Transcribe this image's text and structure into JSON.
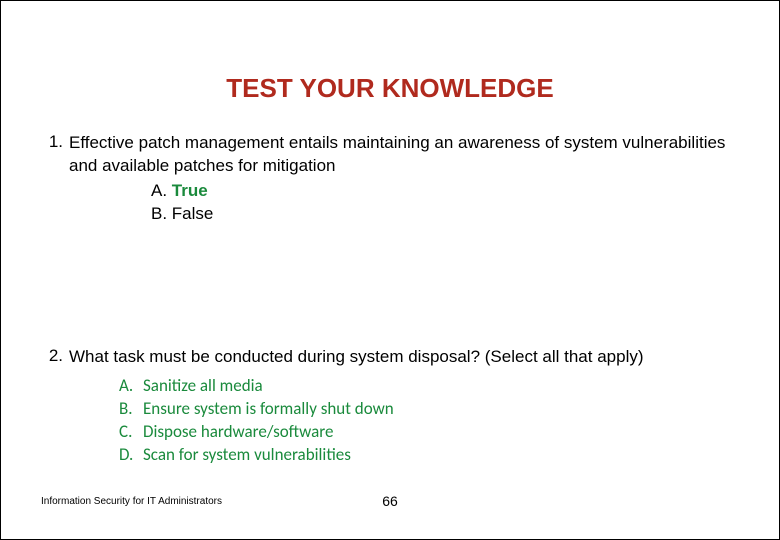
{
  "title": "TEST YOUR KNOWLEDGE",
  "q1": {
    "number": "1.",
    "text": "Effective patch management entails maintaining an awareness of system vulnerabilities and available patches for mitigation",
    "options": {
      "a_label": "A. ",
      "a_text": "True",
      "b_label": "B. ",
      "b_text": "False"
    }
  },
  "q2": {
    "number": "2.",
    "text": "What task must be conducted during system disposal?  (Select all that apply)",
    "options": {
      "a_label": "A.",
      "a_text": "Sanitize all media",
      "b_label": "B.",
      "b_text": "Ensure system is formally shut down",
      "c_label": "C.",
      "c_text": "Dispose hardware/software",
      "d_label": "D.",
      "d_text": "Scan for system vulnerabilities"
    }
  },
  "footer": {
    "left": "Information Security for IT Administrators",
    "page": "66"
  }
}
